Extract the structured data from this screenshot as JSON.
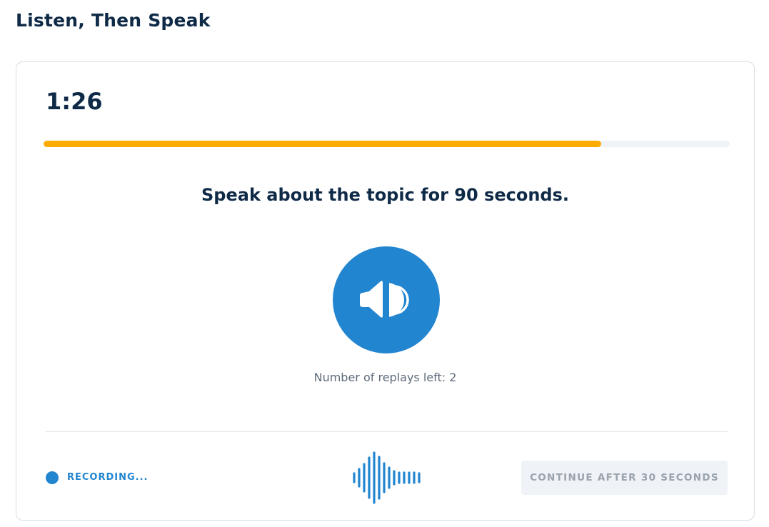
{
  "page_title": "Listen, Then Speak",
  "timer": "1:26",
  "progress": {
    "fraction": 0.813,
    "color": "#ffab00"
  },
  "prompt": "Speak about the topic for 90 seconds.",
  "play_button": {
    "icon": "speaker-audio-icon",
    "color": "#2285d0"
  },
  "replays_text": "Number of replays left: 2",
  "footer": {
    "recording_label": "RECORDING...",
    "recording_icon": "recording-dot-icon",
    "waveform_icon": "audio-waveform-icon",
    "continue_label": "CONTINUE AFTER 30 SECONDS"
  }
}
